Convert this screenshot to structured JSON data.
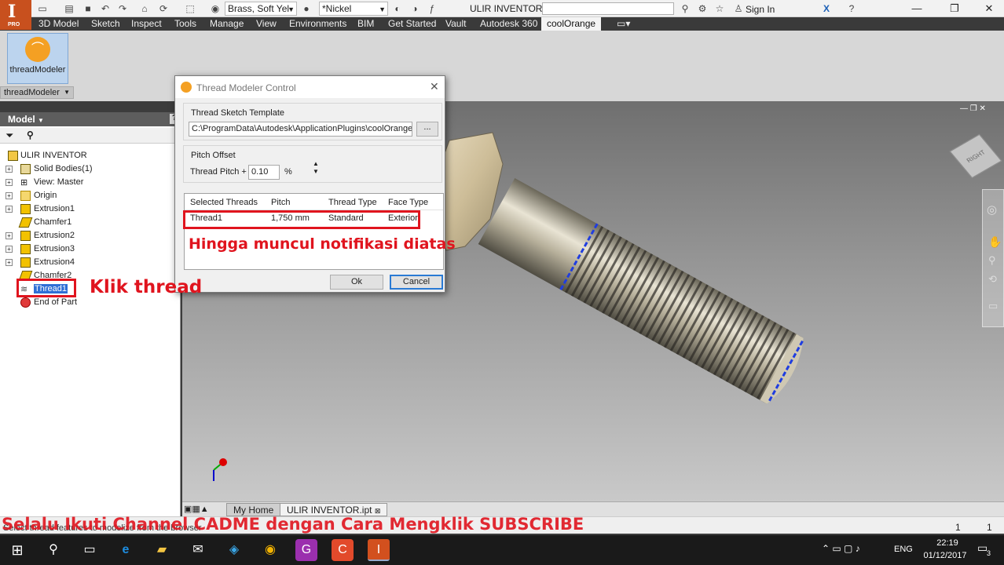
{
  "titlebar": {
    "app_badge": "PRO",
    "material": "Brass, Soft Yel",
    "appearance": "*Nickel",
    "document_title": "ULIR INVENTOR",
    "search_placeholder": "",
    "sign_in": "Sign In"
  },
  "ribbon": {
    "tabs": [
      "3D Model",
      "Sketch",
      "Inspect",
      "Tools",
      "Manage",
      "View",
      "Environments",
      "BIM",
      "Get Started",
      "Vault",
      "Autodesk 360",
      "coolOrange"
    ],
    "active_tab": "coolOrange",
    "button_label": "threadModeler",
    "panel_label": "threadModeler"
  },
  "browser": {
    "header": "Model",
    "tree": [
      {
        "label": "ULIR INVENTOR",
        "expander": false
      },
      {
        "label": "Solid Bodies(1)",
        "expander": true
      },
      {
        "label": "View: Master",
        "expander": true
      },
      {
        "label": "Origin",
        "expander": true
      },
      {
        "label": "Extrusion1",
        "expander": true
      },
      {
        "label": "Chamfer1",
        "expander": false
      },
      {
        "label": "Extrusion2",
        "expander": true
      },
      {
        "label": "Extrusion3",
        "expander": true
      },
      {
        "label": "Extrusion4",
        "expander": true
      },
      {
        "label": "Chamfer2",
        "expander": false
      },
      {
        "label": "Thread1",
        "expander": false,
        "selected": true
      },
      {
        "label": "End of Part",
        "expander": false
      }
    ]
  },
  "dialog": {
    "title": "Thread Modeler Control",
    "sketch_template_label": "Thread Sketch Template",
    "sketch_template_path": "C:\\ProgramData\\Autodesk\\ApplicationPlugins\\coolOrange_co",
    "browse_button": "...",
    "pitch_offset_label": "Pitch Offset",
    "thread_pitch_label": "Thread Pitch +",
    "thread_pitch_value": "0.10",
    "percent": "%",
    "columns": [
      "Selected Threads",
      "Pitch",
      "Thread Type",
      "Face Type"
    ],
    "rows": [
      [
        "Thread1",
        "1,750 mm",
        "Standard",
        "Exterior"
      ]
    ],
    "ok_button": "Ok",
    "cancel_button": "Cancel"
  },
  "annotations": {
    "klik": "Klik thread",
    "notif": "Hingga muncul notifikasi diatas",
    "subscribe": "Selalu Ikuti Channel CADME dengan Cara Mengklik SUBSCRIBE"
  },
  "viewcube_label": "RIGHT",
  "doc_tabs": [
    "My Home",
    "ULIR INVENTOR.ipt"
  ],
  "status": {
    "message": "Select thread features to modelize from the browser",
    "count1": "1",
    "count2": "1"
  },
  "taskbar": {
    "language": "ENG",
    "time": "22:19",
    "date": "01/12/2017",
    "notification_count": "3"
  },
  "colors": {
    "annotation_red": "#e0141e",
    "ribbon_dark": "#3a3a3a",
    "viewport_top": "#6f6f6f",
    "viewport_bottom": "#c9c9c9"
  }
}
